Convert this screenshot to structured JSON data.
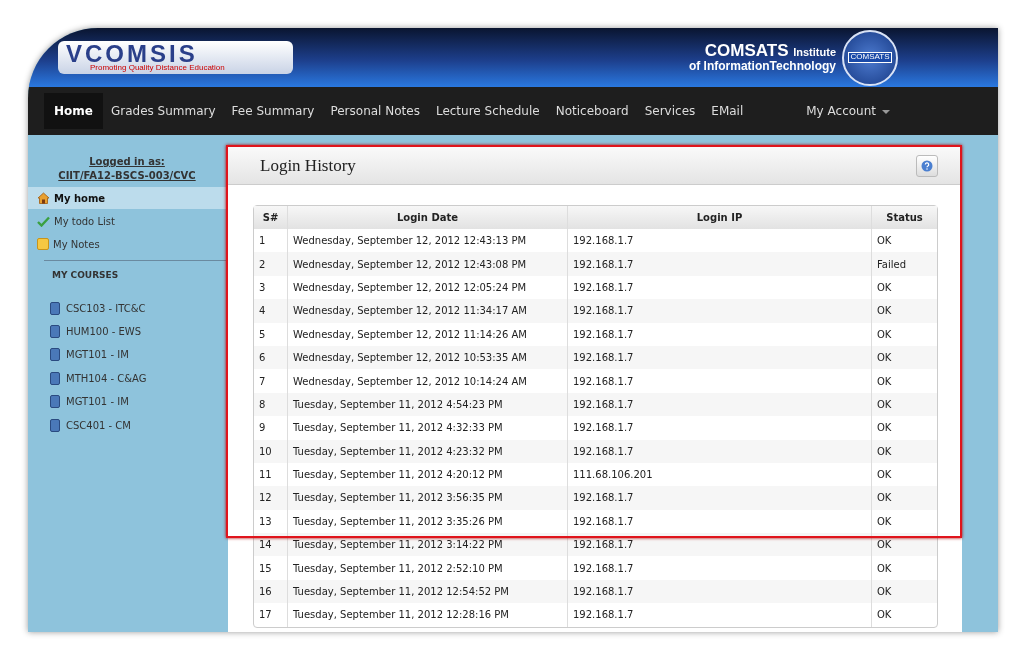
{
  "header": {
    "logo": {
      "title": "VCOMSIS",
      "tagline": "Promoting Quality Distance Education"
    },
    "institute": {
      "name": "COMSATS",
      "suffix": "Institute",
      "line2": "of InformationTechnology",
      "emblem_text": "COMSATS"
    }
  },
  "nav": {
    "items": [
      {
        "label": "Home",
        "selected": true
      },
      {
        "label": "Grades Summary",
        "selected": false
      },
      {
        "label": "Fee Summary",
        "selected": false
      },
      {
        "label": "Personal Notes",
        "selected": false
      },
      {
        "label": "Lecture Schedule",
        "selected": false
      },
      {
        "label": "Noticeboard",
        "selected": false
      },
      {
        "label": "Services",
        "selected": false
      },
      {
        "label": "EMail",
        "selected": false
      }
    ],
    "account": "My Account"
  },
  "sidebar": {
    "logged_in_label": "Logged in as:",
    "user": "CIIT/FA12-BSCS-003/CVC",
    "links": [
      {
        "label": "My home",
        "kind": "home",
        "selected": true
      },
      {
        "label": "My todo List",
        "kind": "check",
        "selected": false
      },
      {
        "label": "My Notes",
        "kind": "note",
        "selected": false
      }
    ],
    "courses_heading": "MY COURSES",
    "courses": [
      "CSC103 - ITC&C",
      "HUM100 - EWS",
      "MGT101 - IM",
      "MTH104 - C&AG",
      "MGT101 - IM",
      "CSC401 - CM"
    ]
  },
  "panel": {
    "title": "Login History",
    "table": {
      "columns": [
        "S#",
        "Login Date",
        "Login IP",
        "Status"
      ],
      "rows": [
        [
          "1",
          "Wednesday, September 12, 2012 12:43:13 PM",
          "192.168.1.7",
          "OK"
        ],
        [
          "2",
          "Wednesday, September 12, 2012 12:43:08 PM",
          "192.168.1.7",
          "Failed"
        ],
        [
          "3",
          "Wednesday, September 12, 2012 12:05:24 PM",
          "192.168.1.7",
          "OK"
        ],
        [
          "4",
          "Wednesday, September 12, 2012 11:34:17 AM",
          "192.168.1.7",
          "OK"
        ],
        [
          "5",
          "Wednesday, September 12, 2012 11:14:26 AM",
          "192.168.1.7",
          "OK"
        ],
        [
          "6",
          "Wednesday, September 12, 2012 10:53:35 AM",
          "192.168.1.7",
          "OK"
        ],
        [
          "7",
          "Wednesday, September 12, 2012 10:14:24 AM",
          "192.168.1.7",
          "OK"
        ],
        [
          "8",
          "Tuesday, September 11, 2012 4:54:23 PM",
          "192.168.1.7",
          "OK"
        ],
        [
          "9",
          "Tuesday, September 11, 2012 4:32:33 PM",
          "192.168.1.7",
          "OK"
        ],
        [
          "10",
          "Tuesday, September 11, 2012 4:23:32 PM",
          "192.168.1.7",
          "OK"
        ],
        [
          "11",
          "Tuesday, September 11, 2012 4:20:12 PM",
          "111.68.106.201",
          "OK"
        ],
        [
          "12",
          "Tuesday, September 11, 2012 3:56:35 PM",
          "192.168.1.7",
          "OK"
        ],
        [
          "13",
          "Tuesday, September 11, 2012 3:35:26 PM",
          "192.168.1.7",
          "OK"
        ],
        [
          "14",
          "Tuesday, September 11, 2012 3:14:22 PM",
          "192.168.1.7",
          "OK"
        ],
        [
          "15",
          "Tuesday, September 11, 2012 2:52:10 PM",
          "192.168.1.7",
          "OK"
        ],
        [
          "16",
          "Tuesday, September 11, 2012 12:54:52 PM",
          "192.168.1.7",
          "OK"
        ],
        [
          "17",
          "Tuesday, September 11, 2012 12:28:16 PM",
          "192.168.1.7",
          "OK"
        ]
      ]
    }
  }
}
